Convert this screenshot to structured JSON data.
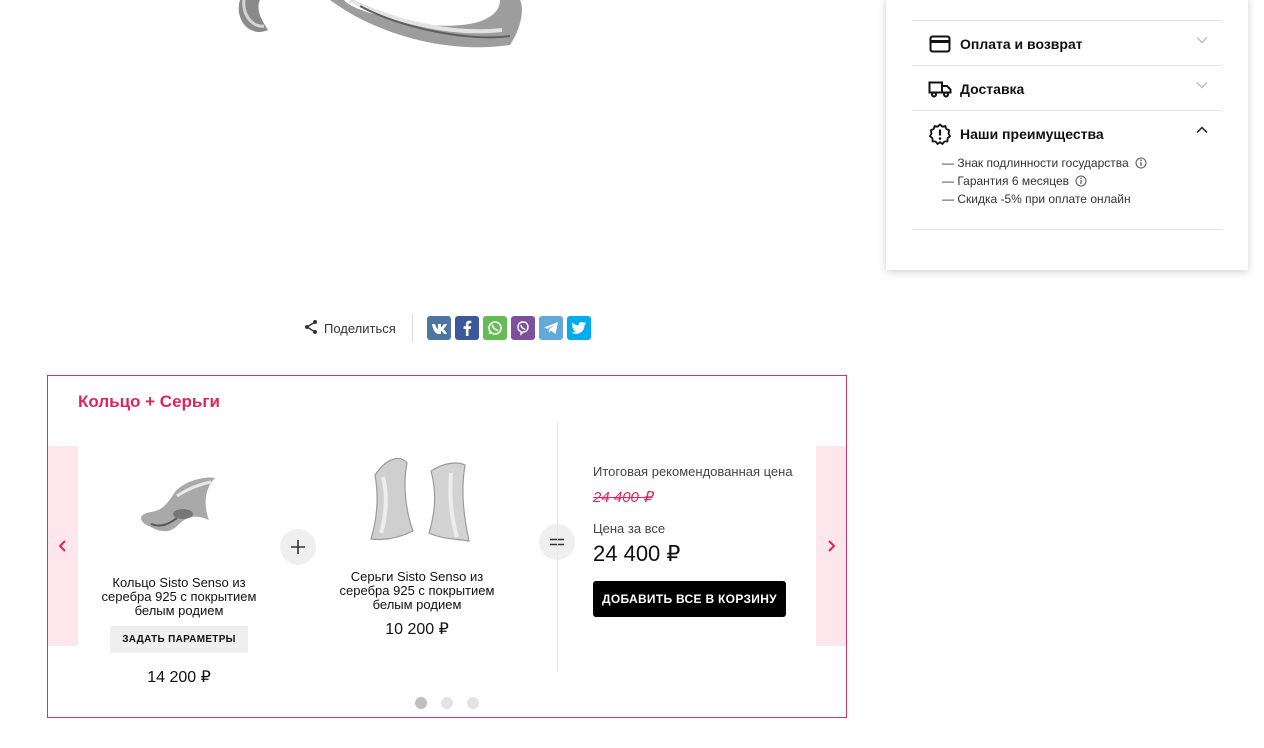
{
  "share": {
    "label": "Поделиться",
    "networks": [
      {
        "icon": "vk-icon",
        "color": "#4c75a3",
        "glyph": "vk"
      },
      {
        "icon": "facebook-icon",
        "color": "#3b5998",
        "glyph": "f"
      },
      {
        "icon": "whatsapp-icon",
        "color": "#65bc54",
        "glyph": "wa"
      },
      {
        "icon": "viber-icon",
        "color": "#7b519d",
        "glyph": "vi"
      },
      {
        "icon": "telegram-icon",
        "color": "#64a9dc",
        "glyph": "tg"
      },
      {
        "icon": "twitter-icon",
        "color": "#00aced",
        "glyph": "tw"
      }
    ]
  },
  "set": {
    "title": "Кольцо + Серьги",
    "accent_color": "#e0245e",
    "items": [
      {
        "name": "Кольцо Sisto Senso из серебра 925 с покрытием белым родием",
        "button_label": "ЗАДАТЬ ПАРАМЕТРЫ",
        "price": "14 200 ₽"
      },
      {
        "name": "Серьги Sisto Senso из серебра 925 с покрытием белым родием",
        "price": "10 200 ₽"
      }
    ],
    "summary": {
      "recommended_label": "Итоговая рекомендованная цена",
      "old_price": "24 400 ₽",
      "all_label": "Цена за все",
      "total_price": "24 400 ₽",
      "add_all_label": "ДОБАВИТЬ ВСЕ В КОРЗИНУ"
    },
    "pagination": {
      "count": 3,
      "active": 1
    }
  },
  "info": {
    "sections": [
      {
        "title": "Оплата и возврат",
        "icon": "credit-card-icon",
        "expanded": false
      },
      {
        "title": "Доставка",
        "icon": "truck-icon",
        "expanded": false
      },
      {
        "title": "Наши преимущества",
        "icon": "badge-alert-icon",
        "expanded": true
      }
    ],
    "advantages": [
      "— Знак подлинности государства",
      "— Гарантия 6 месяцев",
      "— Скидка -5% при оплате онлайн"
    ]
  }
}
